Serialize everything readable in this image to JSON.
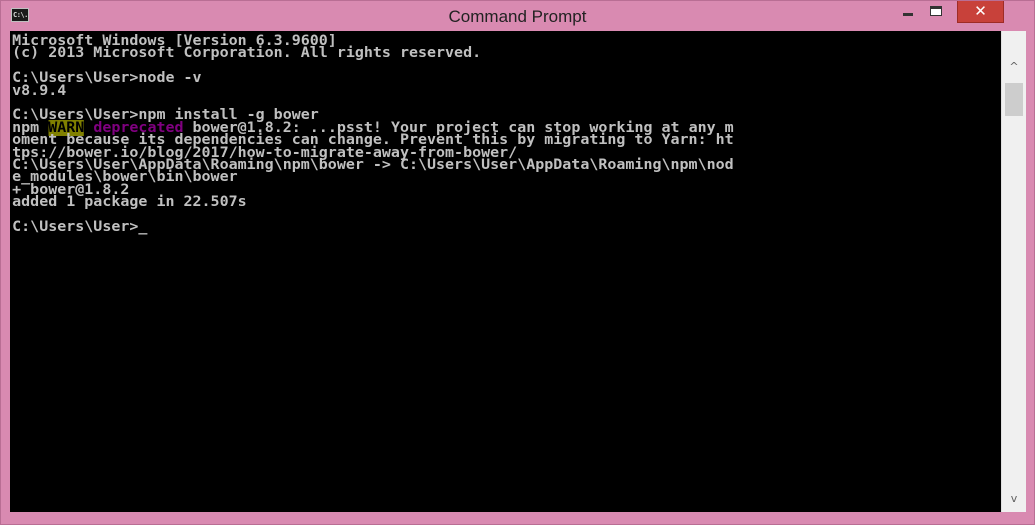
{
  "window": {
    "title": "Command Prompt",
    "icon_text": "C:\\."
  },
  "controls": {
    "minimize_icon": "minimize-icon",
    "maximize_icon": "maximize-icon",
    "close_glyph": "✕"
  },
  "console": {
    "lines": [
      "Microsoft Windows [Version 6.3.9600]",
      "(c) 2013 Microsoft Corporation. All rights reserved.",
      "",
      "C:\\Users\\User>node -v",
      "v8.9.4",
      "",
      "C:\\Users\\User>npm install -g bower"
    ],
    "npm_prefix": "npm ",
    "warn_label": "WARN",
    "deprecated_label": "deprecated",
    "warn_message": " bower@1.8.2: ...psst! Your project can stop working at any m",
    "lines_after": [
      "oment because its dependencies can change. Prevent this by migrating to Yarn: ht",
      "tps://bower.io/blog/2017/how-to-migrate-away-from-bower/",
      "C:\\Users\\User\\AppData\\Roaming\\npm\\bower -> C:\\Users\\User\\AppData\\Roaming\\npm\\nod",
      "e_modules\\bower\\bin\\bower",
      "+ bower@1.8.2",
      "added 1 package in 22.507s",
      "",
      "C:\\Users\\User>"
    ],
    "cursor": "_"
  },
  "scrollbar": {
    "up_glyph": "^",
    "down_glyph": "v"
  },
  "colors": {
    "frame": "#d98ab1",
    "console_bg": "#000000",
    "console_text": "#c0c0c0",
    "warn_bg": "#808000",
    "deprecated": "#800080",
    "close_button": "#c8413a"
  }
}
